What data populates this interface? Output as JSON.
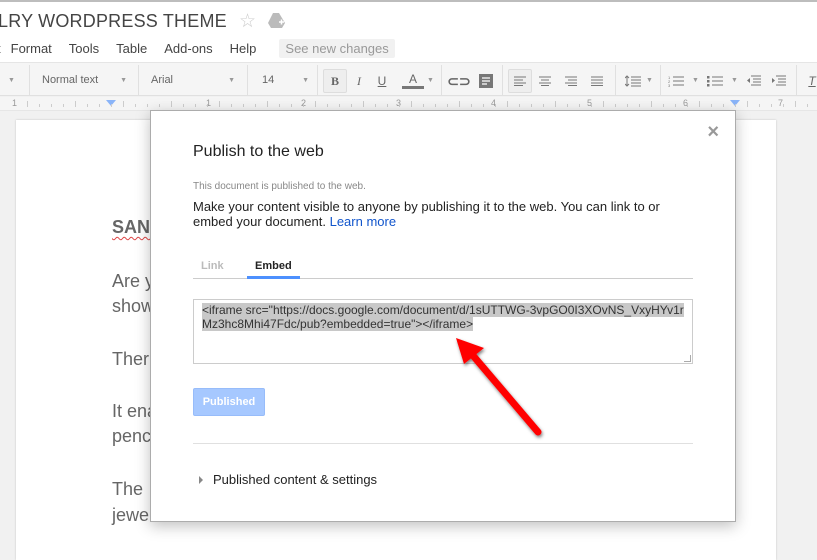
{
  "document": {
    "title": "LRY WORDPRESS THEME",
    "body_lines": [
      "SAN",
      "Are y",
      "show",
      "Ther",
      "It ena",
      "penc",
      "The",
      "jewe"
    ]
  },
  "menu": {
    "items": [
      "t",
      "Format",
      "Tools",
      "Table",
      "Add-ons",
      "Help"
    ],
    "see_new_changes": "See new changes"
  },
  "toolbar": {
    "style": "Normal text",
    "font": "Arial",
    "size": "14",
    "bold": "B",
    "italic": "I",
    "underline": "U",
    "text_color": "A"
  },
  "ruler": {
    "labels": [
      "1",
      "1",
      "2",
      "3",
      "4",
      "5",
      "6",
      "7"
    ]
  },
  "dialog": {
    "title": "Publish to the web",
    "note": "This document is published to the web.",
    "description": "Make your content visible to anyone by publishing it to the web. You can link to or embed your document.",
    "learn_more": "Learn more",
    "tabs": [
      {
        "label": "Link",
        "active": false
      },
      {
        "label": "Embed",
        "active": true
      }
    ],
    "embed_code": "<iframe src=\"https://docs.google.com/document/d/1sUTTWG-3vpGO0I3XOvNS_VxyHYv1rMz3hc8Mhi47Fdc/pub?embedded=true\"></iframe>",
    "published_button": "Published",
    "settings_toggle": "Published content & settings",
    "close": "×"
  },
  "colors": {
    "accent": "#4d90fe",
    "published_button": "#a6c8ff",
    "annotation_arrow": "#ff0000",
    "link": "#1155cc"
  }
}
